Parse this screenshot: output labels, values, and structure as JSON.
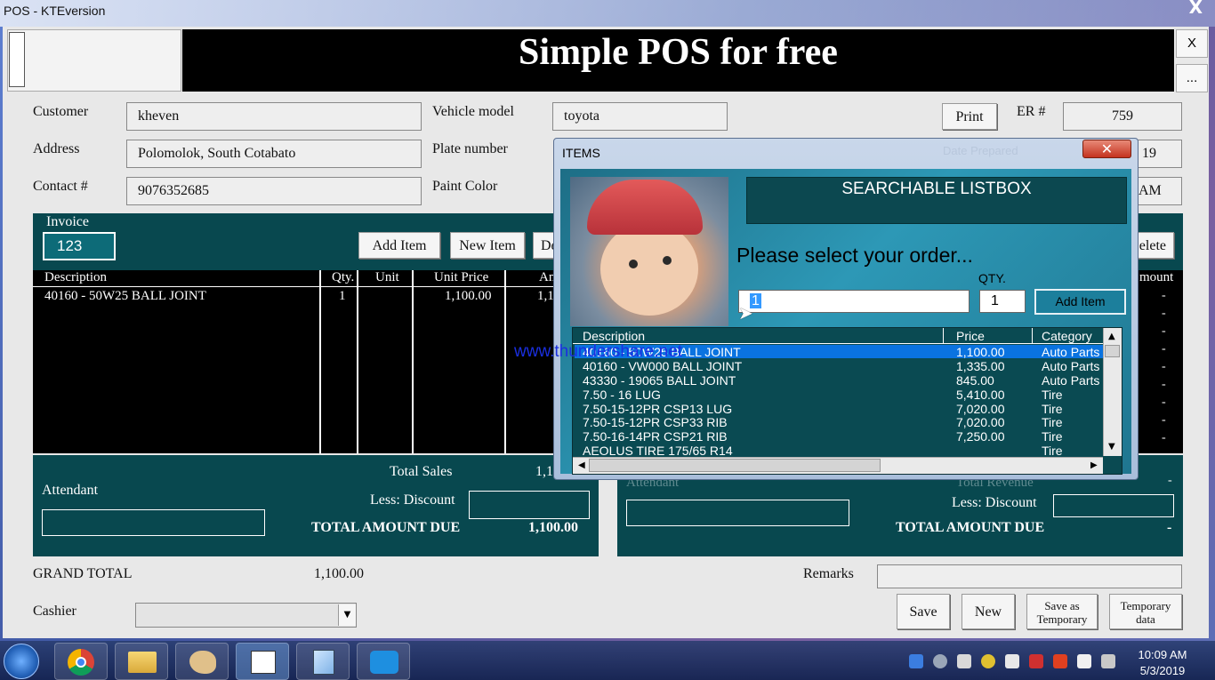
{
  "window": {
    "title": "POS - KTEversion",
    "close_glyph": "X"
  },
  "header": {
    "title": "Simple POS for free",
    "close_btn": "X",
    "more_btn": "..."
  },
  "customer": {
    "customer_label": "Customer",
    "customer_value": "kheven",
    "address_label": "Address",
    "address_value": "Polomolok, South Cotabato",
    "contact_label": "Contact #",
    "contact_value": "9076352685",
    "vehicle_label": "Vehicle model",
    "vehicle_value": "toyota",
    "plate_label": "Plate number",
    "paint_label": "Paint Color",
    "print_btn": "Print",
    "er_label": "ER #",
    "er_value": "759",
    "partial_date": "19",
    "partial_time": "AM"
  },
  "invoice": {
    "label": "Invoice",
    "value": "123",
    "add_item_btn": "Add Item",
    "new_item_btn": "New Item",
    "delete_partial": "De",
    "delete_partial_right": "elete",
    "columns": {
      "description": "Description",
      "qty": "Qty.",
      "unit": "Unit",
      "unit_price": "Unit Price",
      "amount_partial": "An",
      "amount_right_partial": "mount"
    },
    "rows": [
      {
        "description": "40160 - 50W25 BALL JOINT",
        "qty": "1",
        "unit": "",
        "unit_price": "1,100.00",
        "amount_partial": "1,1"
      }
    ],
    "right_dashes": [
      "-",
      "-",
      "-",
      "-",
      "-",
      "-",
      "-",
      "-",
      "-"
    ]
  },
  "totals_left": {
    "total_sales_label": "Total Sales",
    "total_sales_partial": "1,1",
    "attendant_label": "Attendant",
    "discount_label": "Less: Discount",
    "due_label": "TOTAL AMOUNT DUE",
    "due_value": "1,100.00"
  },
  "totals_right": {
    "attendant_partial": "Attendant",
    "revenue_partial": "Total Revenue",
    "dash_top": "-",
    "discount_label": "Less: Discount",
    "due_label": "TOTAL AMOUNT DUE",
    "due_value": "-"
  },
  "footer": {
    "grand_total_label": "GRAND TOTAL",
    "grand_total_value": "1,100.00",
    "remarks_label": "Remarks",
    "cashier_label": "Cashier",
    "save_btn": "Save",
    "new_btn": "New",
    "save_temp_line1": "Save as",
    "save_temp_line2": "Temporary",
    "temp_data_line1": "Temporary",
    "temp_data_line2": "data"
  },
  "dialog": {
    "title": "ITEMS",
    "close_glyph": "✕",
    "header": "SEARCHABLE LISTBOX",
    "prompt": "Please select your order...",
    "search_value": "1",
    "qty_label": "QTY.",
    "qty_value": "1",
    "add_item_btn": "Add Item",
    "columns": {
      "description": "Description",
      "price": "Price",
      "category": "Category"
    },
    "rows": [
      {
        "description": "40160 - 50W25 BALL JOINT",
        "price": "1,100.00",
        "category": "Auto Parts"
      },
      {
        "description": "40160 - VW000 BALL JOINT",
        "price": "1,335.00",
        "category": "Auto Parts"
      },
      {
        "description": "43330 - 19065 BALL JOINT",
        "price": "845.00",
        "category": "Auto Parts"
      },
      {
        "description": "7.50 - 16 LUG",
        "price": "5,410.00",
        "category": "Tire"
      },
      {
        "description": "7.50-15-12PR CSP13 LUG",
        "price": "7,020.00",
        "category": "Tire"
      },
      {
        "description": "7.50-15-12PR CSP33 RIB",
        "price": "7,020.00",
        "category": "Tire"
      },
      {
        "description": "7.50-16-14PR CSP21 RIB",
        "price": "7,250.00",
        "category": "Tire"
      },
      {
        "description": "AEOLUS TIRE 175/65 R14",
        "price": "",
        "category": "Tire"
      }
    ],
    "watermark": "www.thundershare.net",
    "faint_date_label": "Date Prepared"
  },
  "taskbar": {
    "time": "10:09 AM",
    "date": "5/3/2019"
  }
}
